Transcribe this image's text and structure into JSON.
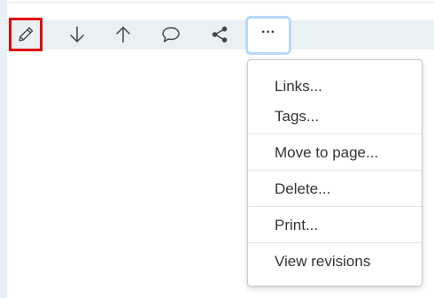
{
  "toolbar": {
    "buttons": [
      {
        "name": "edit",
        "icon": "pencil-icon"
      },
      {
        "name": "move-down",
        "icon": "arrow-down-icon"
      },
      {
        "name": "move-up",
        "icon": "arrow-up-icon"
      },
      {
        "name": "comment",
        "icon": "speech-bubble-icon"
      },
      {
        "name": "share",
        "icon": "share-icon"
      },
      {
        "name": "more",
        "icon": "ellipsis-icon",
        "label": "···"
      }
    ],
    "highlight_color": "#e00000",
    "focus_ring_color": "#b9d8f7",
    "bar_color": "#eaf1f5"
  },
  "menu": {
    "items": [
      {
        "label": "Links..."
      },
      {
        "label": "Tags..."
      },
      {
        "label": "Move to page..."
      },
      {
        "label": "Delete..."
      },
      {
        "label": "Print..."
      },
      {
        "label": "View revisions"
      }
    ]
  }
}
